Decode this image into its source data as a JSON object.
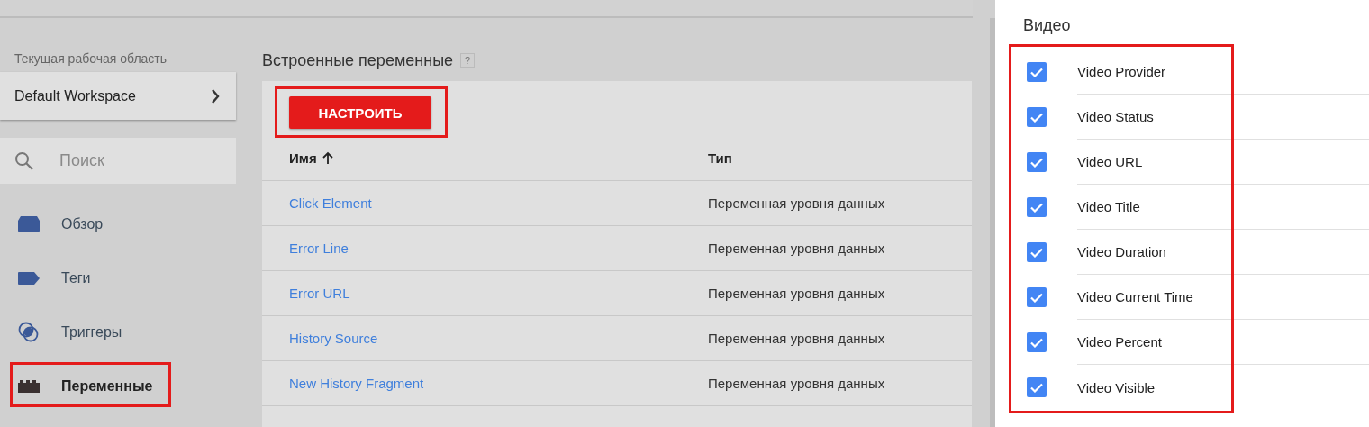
{
  "sidebar": {
    "workspace_label": "Текущая рабочая область",
    "workspace": "Default Workspace",
    "search": {
      "placeholder": "Поиск"
    },
    "items": [
      {
        "label": "Обзор",
        "kind": "overview",
        "selected": false
      },
      {
        "label": "Теги",
        "kind": "tags",
        "selected": false
      },
      {
        "label": "Триггеры",
        "kind": "triggers",
        "selected": false
      },
      {
        "label": "Переменные",
        "kind": "variables",
        "selected": true,
        "highlighted": true
      }
    ]
  },
  "main": {
    "title": "Встроенные переменные",
    "help": "?",
    "configure_button": {
      "label": "НАСТРОИТЬ",
      "highlighted": true
    },
    "table": {
      "columns": [
        {
          "label": "Имя",
          "sorted_ascending": true
        },
        {
          "label": "Тип"
        }
      ],
      "rows": [
        [
          "Click Element",
          "Переменная уровня данных"
        ],
        [
          "Error Line",
          "Переменная уровня данных"
        ],
        [
          "Error URL",
          "Переменная уровня данных"
        ],
        [
          "History Source",
          "Переменная уровня данных"
        ],
        [
          "New History Fragment",
          "Переменная уровня данных"
        ]
      ]
    }
  },
  "panel": {
    "section": "Видео",
    "highlighted": true,
    "items": [
      {
        "label": "Video Provider",
        "checked": true
      },
      {
        "label": "Video Status",
        "checked": true
      },
      {
        "label": "Video URL",
        "checked": true
      },
      {
        "label": "Video Title",
        "checked": true
      },
      {
        "label": "Video Duration",
        "checked": true
      },
      {
        "label": "Video Current Time",
        "checked": true
      },
      {
        "label": "Video Percent",
        "checked": true
      },
      {
        "label": "Video Visible",
        "checked": true
      }
    ]
  }
}
